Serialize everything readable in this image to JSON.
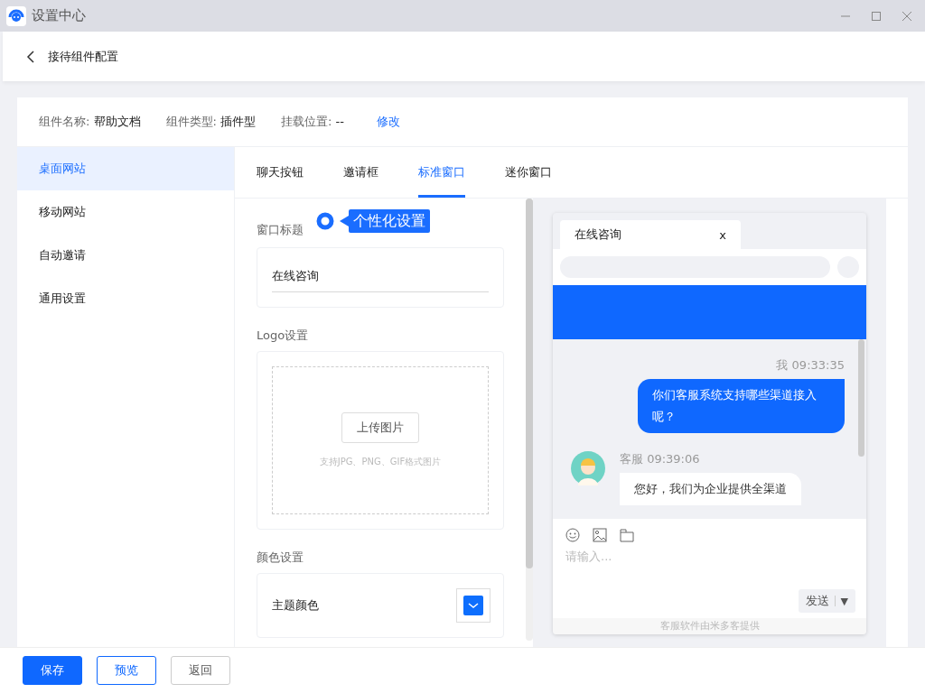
{
  "window": {
    "title": "设置中心"
  },
  "header": {
    "title": "接待组件配置"
  },
  "info": [
    {
      "label": "组件名称:",
      "value": "帮助文档"
    },
    {
      "label": "组件类型:",
      "value": "插件型"
    },
    {
      "label": "挂载位置:",
      "value": "--"
    }
  ],
  "edit_link": "修改",
  "sidebar": {
    "items": [
      {
        "label": "桌面网站",
        "selected": true
      },
      {
        "label": "移动网站",
        "selected": false
      },
      {
        "label": "自动邀请",
        "selected": false
      },
      {
        "label": "通用设置",
        "selected": false
      }
    ]
  },
  "tabs": [
    {
      "label": "聊天按钮",
      "selected": false
    },
    {
      "label": "邀请框",
      "selected": false
    },
    {
      "label": "标准窗口",
      "selected": true
    },
    {
      "label": "迷你窗口",
      "selected": false
    }
  ],
  "form": {
    "title_label": "窗口标题",
    "title_value": "在线咨询",
    "logo_label": "Logo设置",
    "upload_button": "上传图片",
    "upload_hint": "支持JPG、PNG、GIF格式图片",
    "color_label": "颜色设置",
    "theme_label": "主题颜色"
  },
  "callout": "个性化设置",
  "preview": {
    "tab_title": "在线咨询",
    "tab_close": "x",
    "messages": [
      {
        "kind": "me",
        "meta": "我 09:33:35",
        "text": "你们客服系统支持哪些渠道接入呢？"
      },
      {
        "kind": "agent",
        "meta": "客服 09:39:06",
        "text": "您好，我们为企业提供全渠道"
      }
    ],
    "input_placeholder": "请输入...",
    "send": "发送",
    "send_caret": "▼",
    "footer": "客服软件由米多客提供"
  },
  "buttons": [
    {
      "label": "保存",
      "kind": "primary"
    },
    {
      "label": "预览",
      "kind": "outline"
    },
    {
      "label": "返回",
      "kind": "plain"
    }
  ]
}
